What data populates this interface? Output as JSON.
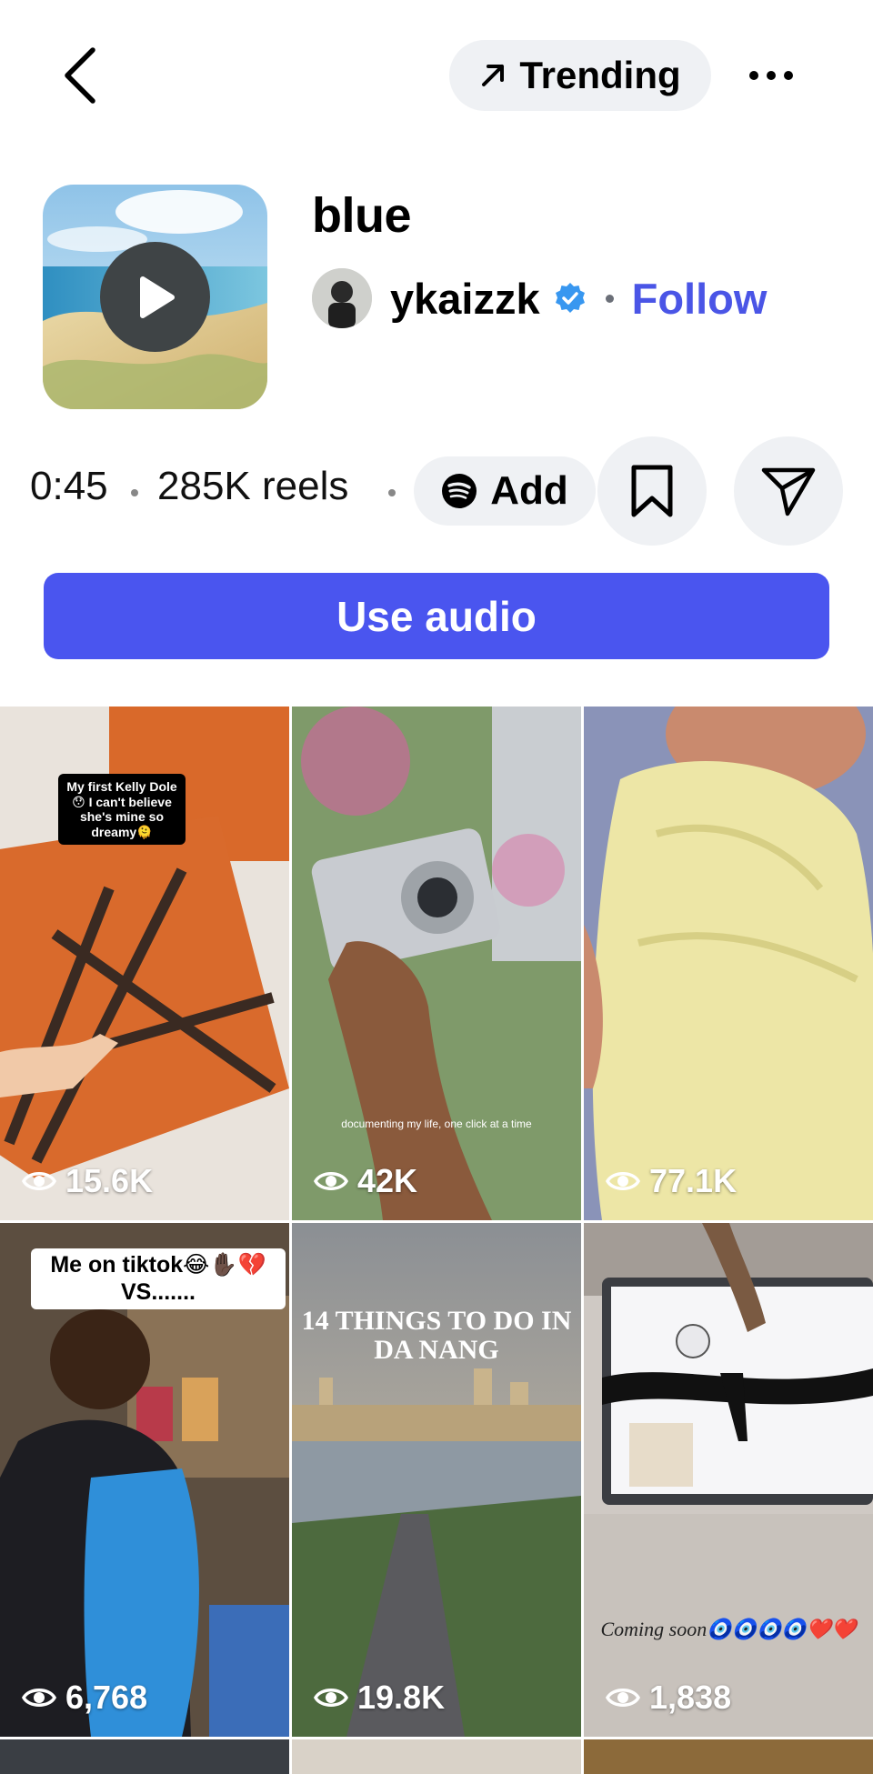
{
  "header": {
    "back_icon": "chevron-left-icon",
    "trending_label": "Trending",
    "trending_icon": "arrow-up-right-icon",
    "more_icon": "more-horizontal-icon"
  },
  "audio": {
    "title": "blue",
    "artist": "ykaizzk",
    "verified": true,
    "follow_label": "Follow",
    "duration": "0:45",
    "reels_count": "285K reels",
    "add_label": "Add",
    "add_icon": "spotify-icon",
    "use_audio_label": "Use audio"
  },
  "colors": {
    "accent": "#4a55ef",
    "follow_blue": "#4a55e6",
    "verified_blue": "#3897f0",
    "pill_bg": "#eff1f4"
  },
  "reels": [
    {
      "views": "15.6K",
      "caption": "My first Kelly Dole😯 I can't believe she's mine so dreamy🫠"
    },
    {
      "views": "42K",
      "caption": "documenting my life, one click at a time"
    },
    {
      "views": "77.1K",
      "caption": ""
    },
    {
      "views": "6,768",
      "caption": "Me on tiktok😂✋🏿💔 VS......."
    },
    {
      "views": "19.8K",
      "caption": "14 THINGS TO DO IN DA NANG"
    },
    {
      "views": "1,838",
      "caption": "Coming soon🧿🧿🧿🧿❤️❤️"
    }
  ]
}
